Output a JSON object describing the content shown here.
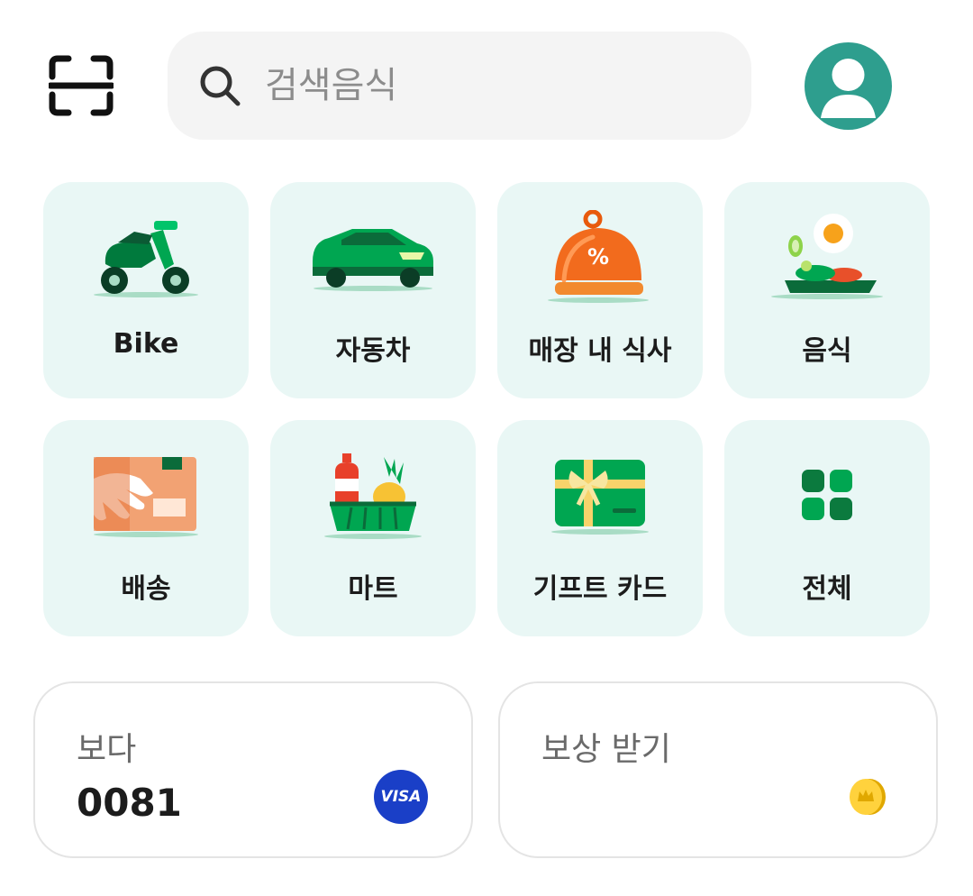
{
  "header": {
    "search": {
      "placeholder": "검색음식",
      "value": ""
    }
  },
  "services": [
    {
      "label": "Bike",
      "icon": "motorbike-icon"
    },
    {
      "label": "자동차",
      "icon": "car-icon"
    },
    {
      "label": "매장 내 식사",
      "icon": "dine-in-cloche-icon"
    },
    {
      "label": "음식",
      "icon": "food-plate-icon"
    },
    {
      "label": "배송",
      "icon": "delivery-box-icon"
    },
    {
      "label": "마트",
      "icon": "grocery-basket-icon"
    },
    {
      "label": "기프트 카드",
      "icon": "gift-card-icon"
    },
    {
      "label": "전체",
      "icon": "all-grid-icon"
    }
  ],
  "cards": {
    "payment": {
      "title": "보다",
      "value": "0081",
      "badge": "VISA",
      "badge_color": "#1a3fc7"
    },
    "rewards": {
      "title": "보상 받기",
      "icon": "coin-icon"
    }
  },
  "colors": {
    "brand_green": "#00a651",
    "tile_bg": "#e9f7f5",
    "avatar_bg": "#2e9e8e"
  }
}
